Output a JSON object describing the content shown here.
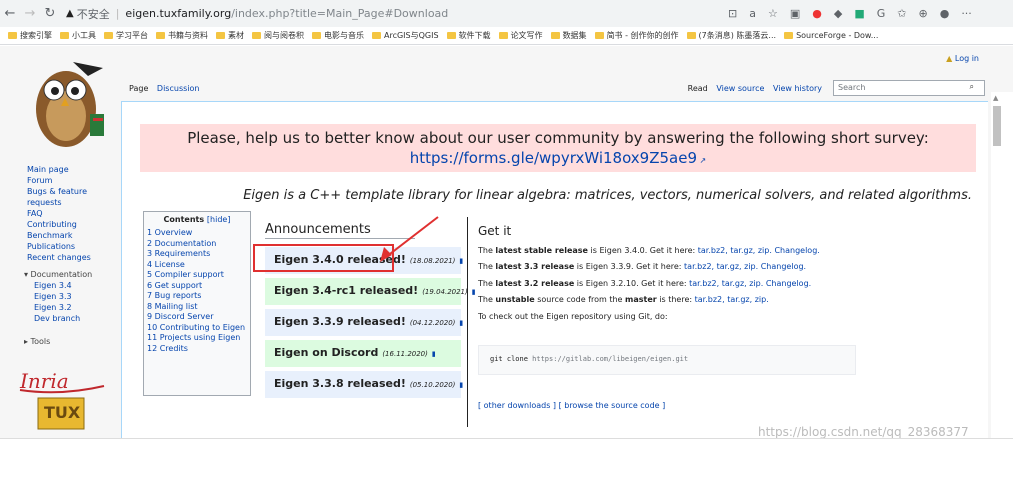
{
  "browser": {
    "insecure_label": "不安全",
    "url_host": "eigen.tuxfamily.org",
    "url_path": "/index.php?title=Main_Page#Download",
    "bookmarks": [
      "搜索引擎",
      "小工具",
      "学习平台",
      "书籍与资料",
      "素材",
      "阅与阅卷积",
      "电影与音乐",
      "ArcGIS与QGIS",
      "软件下载",
      "论文写作",
      "数据集",
      "简书 - 创作你的创作",
      "(7条消息) 陈墨落云...",
      "SourceForge - Dow..."
    ]
  },
  "header": {
    "login": "Log in",
    "tab_page": "Page",
    "tab_discussion": "Discussion",
    "tab_read": "Read",
    "tab_view_source": "View source",
    "tab_view_history": "View history",
    "search_placeholder": "Search"
  },
  "sidebar": {
    "nav": [
      "Main page",
      "Forum",
      "Bugs & feature",
      "requests",
      "FAQ",
      "Contributing",
      "Benchmark",
      "Publications",
      "Recent changes"
    ],
    "documentation_header": "Documentation",
    "docs": [
      "Eigen 3.4",
      "Eigen 3.3",
      "Eigen 3.2",
      "Dev branch"
    ],
    "tools_header": "Tools"
  },
  "survey": {
    "text": "Please, help us to better know about our user community by answering the following short survey:",
    "link": "https://forms.gle/wpyrxWi18ox9Z5ae9"
  },
  "tagline": "Eigen is a C++ template library for linear algebra: matrices, vectors, numerical solvers, and related algorithms.",
  "toc": {
    "title": "Contents",
    "hide": "[hide]",
    "items": [
      "1 Overview",
      "2 Documentation",
      "3 Requirements",
      "4 License",
      "5 Compiler support",
      "6 Get support",
      "7 Bug reports",
      "8 Mailing list",
      "9 Discord Server",
      "10 Contributing to Eigen",
      "11 Projects using Eigen",
      "12 Credits"
    ]
  },
  "announcements": {
    "heading": "Announcements",
    "items": [
      {
        "title": "Eigen 3.4.0 released!",
        "date": "(18.08.2021)"
      },
      {
        "title": "Eigen 3.4-rc1 released!",
        "date": "(19.04.2021)"
      },
      {
        "title": "Eigen 3.3.9 released!",
        "date": "(04.12.2020)"
      },
      {
        "title": "Eigen on Discord",
        "date": "(16.11.2020)"
      },
      {
        "title": "Eigen 3.3.8 released!",
        "date": "(05.10.2020)"
      }
    ]
  },
  "getit": {
    "heading": "Get it",
    "lines": [
      {
        "pre": "The ",
        "bold": "latest stable release",
        "mid": " is Eigen 3.4.0. Get it here: ",
        "links": "tar.bz2, tar.gz, zip. Changelog."
      },
      {
        "pre": "The ",
        "bold": "latest 3.3 release",
        "mid": " is Eigen 3.3.9. Get it here: ",
        "links": "tar.bz2, tar.gz, zip. Changelog."
      },
      {
        "pre": "The ",
        "bold": "latest 3.2 release",
        "mid": " is Eigen 3.2.10. Get it here: ",
        "links": "tar.bz2, tar.gz, zip. Changelog."
      },
      {
        "pre": "The ",
        "bold": "unstable",
        "mid": " source code from the ",
        "bold2": "master",
        "mid2": " is there: ",
        "links": "tar.bz2, tar.gz, zip."
      }
    ],
    "checkout": "To check out the Eigen repository using Git, do:",
    "code_cmd": "git clone ",
    "code_url": "https://gitlab.com/libeigen/eigen.git",
    "other_downloads": "[ other downloads ] [ browse the source code ]"
  },
  "watermark": "https://blog.csdn.net/qq_28368377",
  "colors": {
    "link": "#0645ad",
    "survey_bg": "#ffdddd",
    "highlight": "#e03030"
  }
}
